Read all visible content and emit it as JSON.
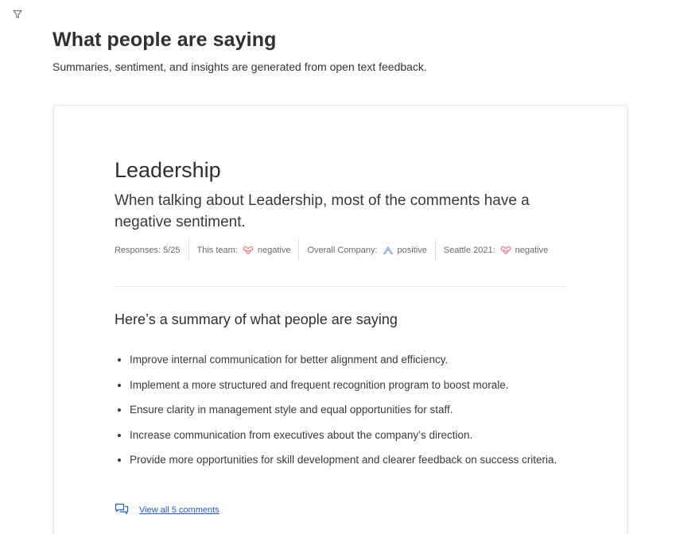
{
  "header": {
    "title": "What people are saying",
    "subtitle": "Summaries, sentiment, and insights are generated from open text feedback."
  },
  "topic": {
    "title": "Leadership",
    "description": "When talking about Leadership, most of the comments have a negative sentiment."
  },
  "meta": {
    "responses_label": "Responses:",
    "responses_value": "5/25",
    "items": [
      {
        "label": "This team:",
        "sentiment": "negative",
        "icon": "heart-negative-icon"
      },
      {
        "label": "Overall Company:",
        "sentiment": "positive",
        "icon": "chevron-positive-icon"
      },
      {
        "label": "Seattle 2021:",
        "sentiment": "negative",
        "icon": "heart-negative-icon"
      }
    ]
  },
  "summary": {
    "heading": "Here’s a summary of what people are saying",
    "bullets": [
      "Improve internal communication for better alignment and efficiency.",
      "Implement a more structured and frequent recognition program to boost morale.",
      "Ensure clarity in management style and equal opportunities for staff.",
      "Increase communication from executives about the company’s direction.",
      "Provide more opportunities for skill development and clearer feedback on success criteria."
    ]
  },
  "comments": {
    "view_all_label": "View all 5 comments",
    "icon": "comments-icon"
  },
  "colors": {
    "negative": "#e8737f",
    "positive": "#8aaad6",
    "link": "#1f5fbf"
  }
}
